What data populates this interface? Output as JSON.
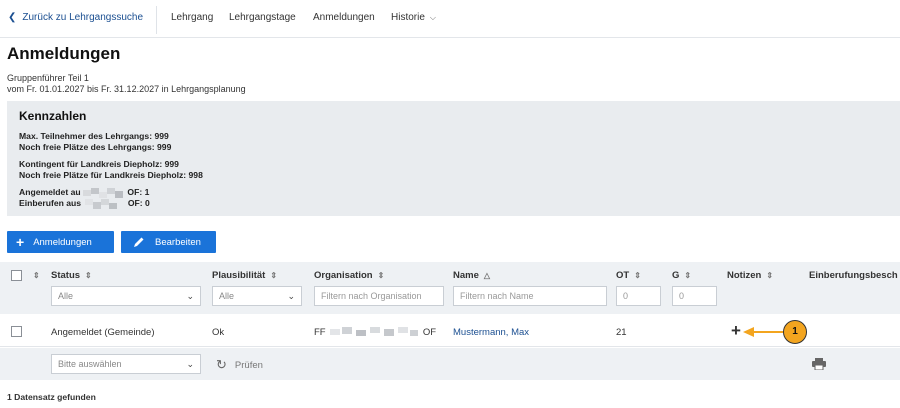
{
  "nav": {
    "back_label": "Zurück zu Lehrgangssuche",
    "links": [
      "Lehrgang",
      "Lehrgangstage",
      "Anmeldungen",
      "Historie"
    ]
  },
  "page": {
    "title": "Anmeldungen",
    "subtitle_course": "Gruppenführer Teil 1",
    "subtitle_period": "vom Fr. 01.01.2027 bis Fr. 31.12.2027 in Lehrgangsplanung"
  },
  "kennzahlen": {
    "title": "Kennzahlen",
    "max_participants": "Max. Teilnehmer des Lehrgangs: 999",
    "free_places": "Noch freie Plätze des Lehrgangs: 999",
    "quota": "Kontingent für Landkreis Diepholz: 999",
    "free_quota": "Noch freie Plätze für Landkreis Diepholz: 998",
    "registered_prefix": "Angemeldet au",
    "registered_suffix": "OF: 1",
    "called_prefix": "Einberufen aus",
    "called_suffix": "OF: 0"
  },
  "buttons": {
    "registrations": "Anmeldungen",
    "edit": "Bearbeiten"
  },
  "table": {
    "headers": {
      "status": "Status",
      "plausibility": "Plausibilität",
      "organisation": "Organisation",
      "name": "Name",
      "ot": "OT",
      "g": "G",
      "notes": "Notizen",
      "call": "Einberufungsbesch"
    },
    "filters": {
      "status": "Alle",
      "plausibility": "Alle",
      "organisation_placeholder": "Filtern nach Organisation",
      "name_placeholder": "Filtern nach Name",
      "ot_placeholder": "0",
      "g_placeholder": "0"
    },
    "rows": [
      {
        "status": "Angemeldet (Gemeinde)",
        "plausibility": "Ok",
        "organisation_prefix": "FF",
        "organisation_suffix": "OF",
        "name": "Mustermann, Max",
        "ot": "21"
      }
    ]
  },
  "actions": {
    "select_placeholder": "Bitte auswählen",
    "check_label": "Prüfen"
  },
  "footer": "1 Datensatz gefunden",
  "annotation": {
    "number": "1",
    "color": "#f3a51f"
  },
  "colors": {
    "primary": "#1a73d9",
    "link": "#1b4f91"
  }
}
